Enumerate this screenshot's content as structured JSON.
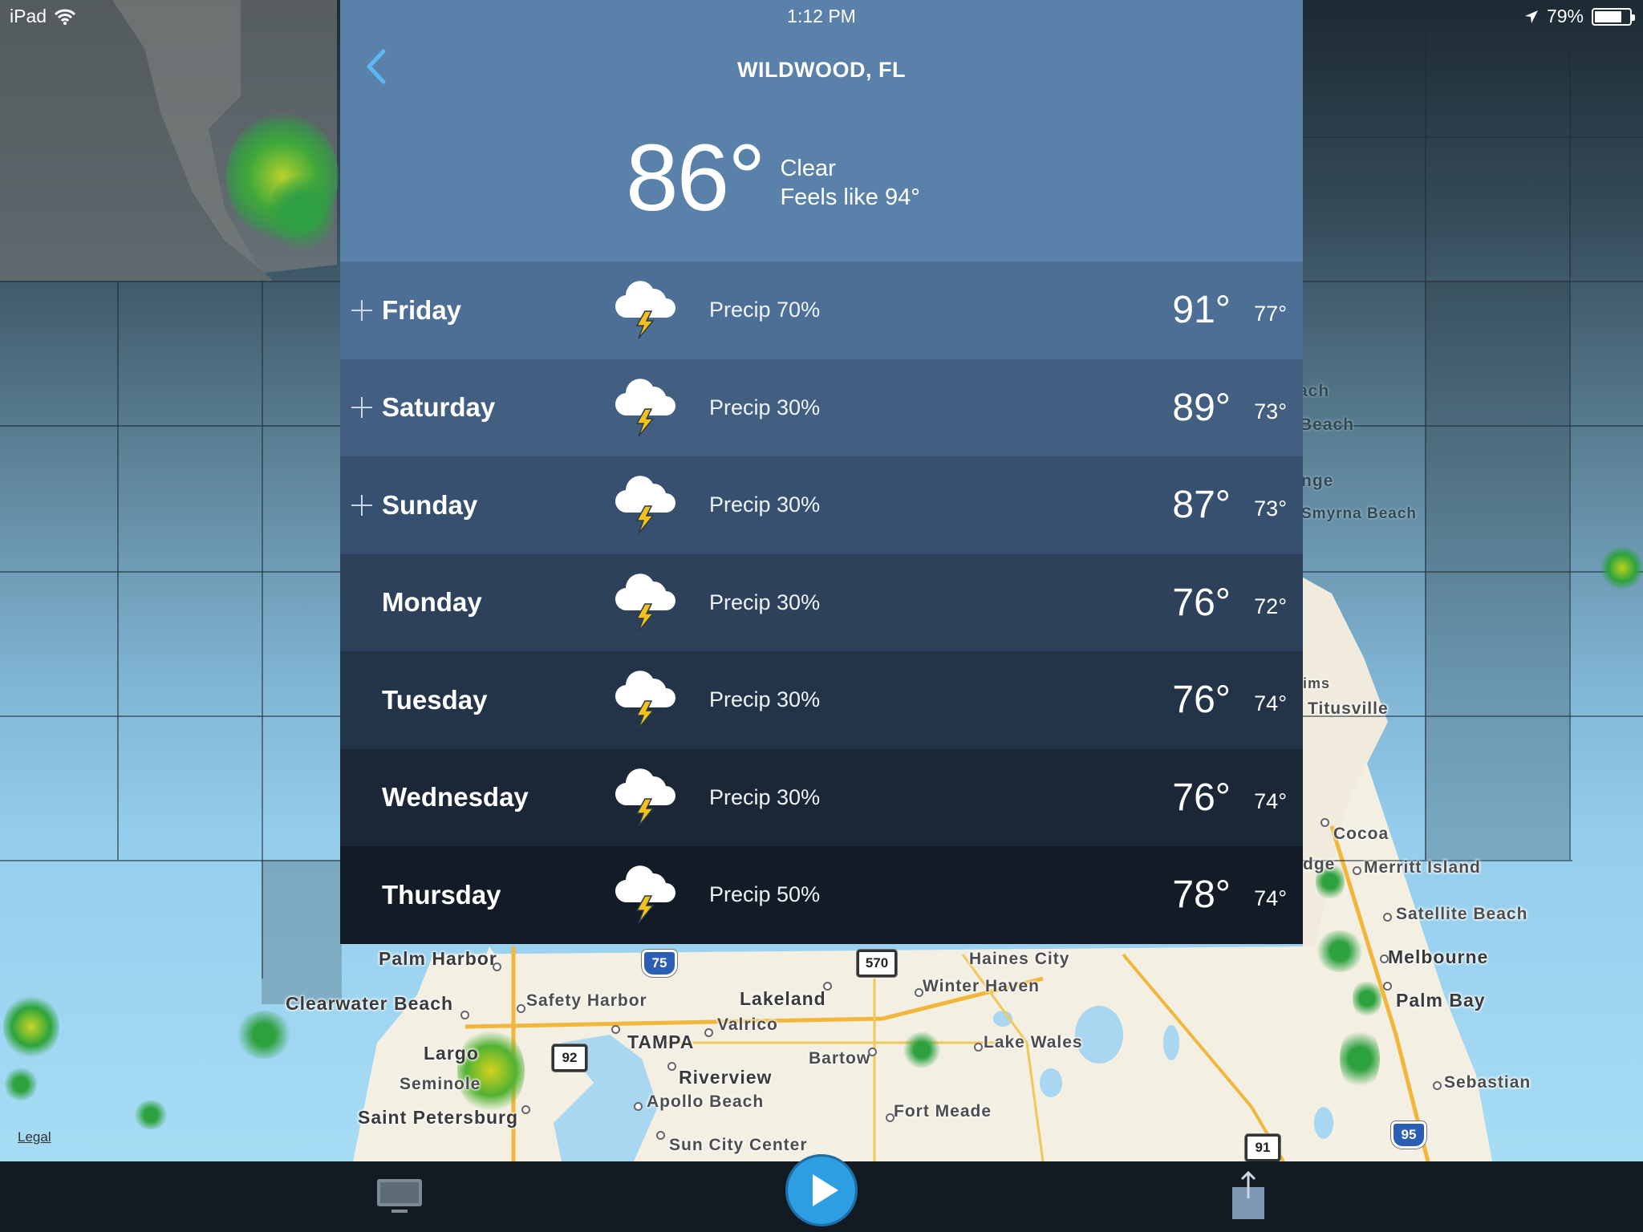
{
  "status_bar": {
    "device": "iPad",
    "time": "1:12 PM",
    "battery": "79%",
    "battery_level": 0.79
  },
  "header": {
    "back_icon": "chevron-left-icon",
    "city": "WILDWOOD, FL",
    "current_temp": "86°",
    "condition": "Clear",
    "feels_like": "Feels like 94°"
  },
  "forecast": [
    {
      "day": "Friday",
      "precip": "Precip 70%",
      "hi": "91°",
      "lo": "77°",
      "expandable": true,
      "icon": "thunderstorm-icon",
      "bg": "#4d6f95"
    },
    {
      "day": "Saturday",
      "precip": "Precip 30%",
      "hi": "89°",
      "lo": "73°",
      "expandable": true,
      "icon": "thunderstorm-icon",
      "bg": "#425f82"
    },
    {
      "day": "Sunday",
      "precip": "Precip 30%",
      "hi": "87°",
      "lo": "73°",
      "expandable": true,
      "icon": "thunderstorm-icon",
      "bg": "#37506f"
    },
    {
      "day": "Monday",
      "precip": "Precip 30%",
      "hi": "76°",
      "lo": "72°",
      "expandable": false,
      "icon": "thunderstorm-icon",
      "bg": "#2d415b"
    },
    {
      "day": "Tuesday",
      "precip": "Precip 30%",
      "hi": "76°",
      "lo": "74°",
      "expandable": false,
      "icon": "thunderstorm-icon",
      "bg": "#243448"
    },
    {
      "day": "Wednesday",
      "precip": "Precip 30%",
      "hi": "76°",
      "lo": "74°",
      "expandable": false,
      "icon": "thunderstorm-icon",
      "bg": "#1b2736"
    },
    {
      "day": "Thursday",
      "precip": "Precip 50%",
      "hi": "78°",
      "lo": "74°",
      "expandable": false,
      "icon": "thunderstorm-icon",
      "bg": "#121b26"
    }
  ],
  "map": {
    "legal": "Legal",
    "labels": {
      "palm_harbor": "Palm Harbor",
      "clearwater_beach": "Clearwater Beach",
      "safety_harbor": "Safety Harbor",
      "tampa": "TAMPA",
      "lakeland": "Lakeland",
      "valrico": "Valrico",
      "largo": "Largo",
      "seminole": "Seminole",
      "saint_petersburg": "Saint Petersburg",
      "riverview": "Riverview",
      "apollo_beach": "Apollo Beach",
      "sun_city_center": "Sun City Center",
      "bartow": "Bartow",
      "fort_meade": "Fort Meade",
      "lake_wales": "Lake Wales",
      "winter_haven": "Winter Haven",
      "haines_city": "Haines City",
      "melbourne": "Melbourne",
      "palm_bay": "Palm Bay",
      "sebastian": "Sebastian",
      "satellite_beach": "Satellite Beach",
      "merritt_island": "Merritt Island",
      "cocoa": "Cocoa",
      "titusville": "Titusville",
      "ims": "ims",
      "smyrna_beach": "Smyrna Beach",
      "nge": "nge",
      "beach": "Beach",
      "ach": "ach",
      "dge": "dge"
    },
    "shields": {
      "i75": "75",
      "r570": "570",
      "us92": "92",
      "i95": "95",
      "r91": "91"
    }
  },
  "toolbar": {
    "tv_icon": "monitor-icon",
    "play_icon": "play-icon",
    "share_icon": "share-icon"
  },
  "colors": {
    "header_bg": "#5a81aa",
    "play_button": "#2e9ee3",
    "back_chevron": "#5ab8f5",
    "toolbar_bg": "#131a21"
  }
}
